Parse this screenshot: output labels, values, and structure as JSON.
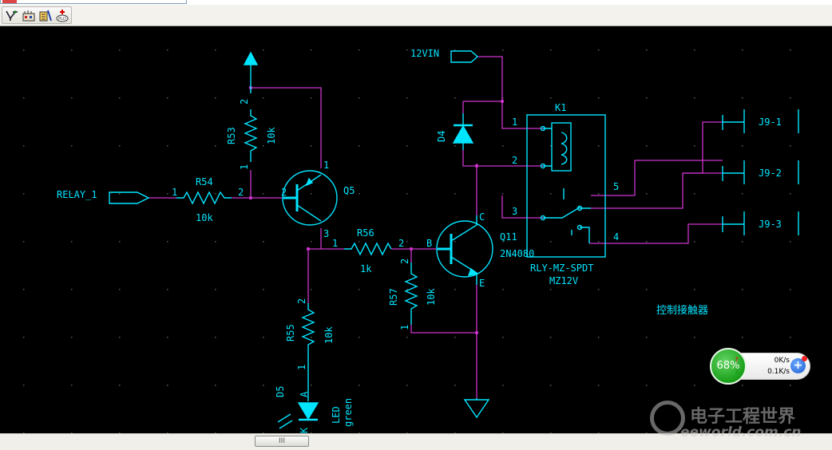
{
  "toolbar": {
    "buttons": [
      {
        "name": "wire-tool-icon"
      },
      {
        "name": "bus-tool-icon"
      },
      {
        "name": "part-tool-icon"
      },
      {
        "name": "add-power-icon"
      }
    ]
  },
  "schematic": {
    "nets": {
      "relay_in": "RELAY_1",
      "supply": "12VIN"
    },
    "components": {
      "r54": {
        "ref": "R54",
        "value": "10k"
      },
      "r53": {
        "ref": "R53",
        "value": "10k"
      },
      "r56": {
        "ref": "R56",
        "value": "1k"
      },
      "r57": {
        "ref": "R57",
        "value": "10k"
      },
      "r55": {
        "ref": "R55",
        "value": "10k"
      },
      "q5": {
        "ref": "Q5"
      },
      "q11": {
        "ref": "Q11",
        "value": "2N4080"
      },
      "d4": {
        "ref": "D4"
      },
      "d5": {
        "ref": "D5",
        "value": "LED",
        "color": "green"
      },
      "k1": {
        "ref": "K1",
        "part": "RLY-MZ-SPDT",
        "value": "MZ12V"
      }
    },
    "pins": {
      "one": "1",
      "two": "2",
      "three": "3",
      "four": "4",
      "five": "5",
      "b": "B",
      "c": "C",
      "e": "E",
      "a": "A",
      "k": "K"
    },
    "connectors": [
      "J9-1",
      "J9-2",
      "J9-3"
    ],
    "note": "控制接触器"
  },
  "network_widget": {
    "percent": "68%",
    "upload": "0K/s",
    "download": "0.1K/s",
    "up_arrow": "↑",
    "down_arrow": "↓",
    "plus": "+"
  },
  "scrollbar": {
    "thumb_grip": "III"
  },
  "watermark": {
    "site": "eeworld.com.cn",
    "cn_name": "电子工程世界"
  },
  "colors": {
    "canvas": "#000000",
    "component": "#00e5ff",
    "wire": "#cc33cc",
    "label_bg": "#001a33"
  }
}
